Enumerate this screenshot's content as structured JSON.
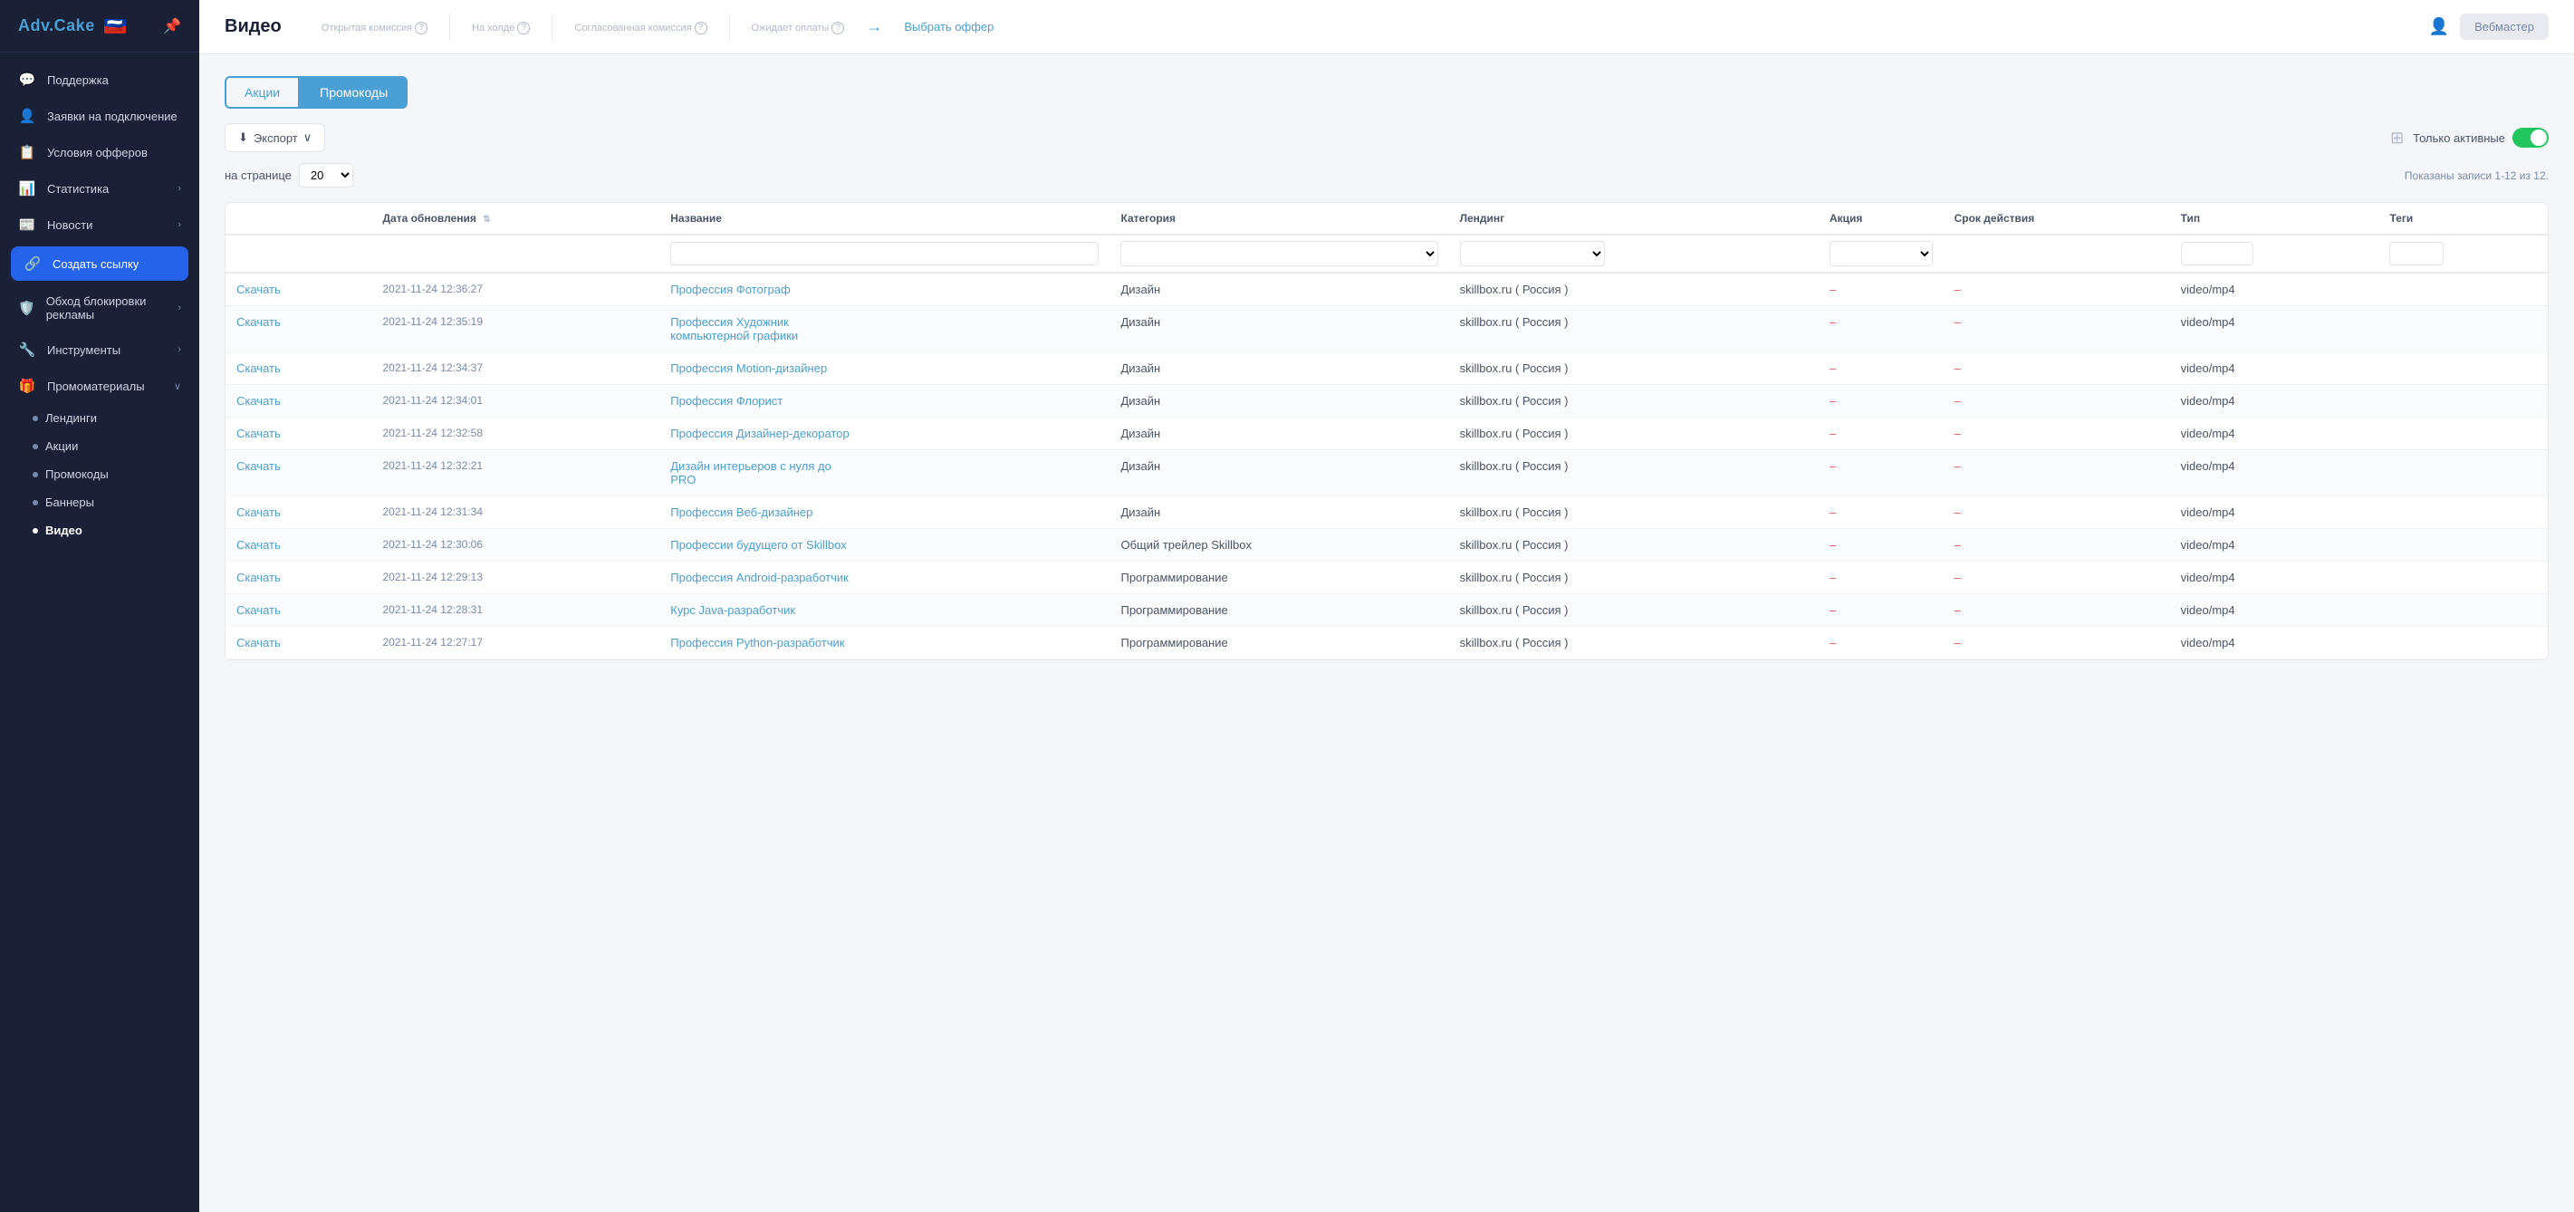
{
  "sidebar": {
    "logo": "Adv.Cake",
    "flag": "🇷🇺",
    "nav_items": [
      {
        "id": "support",
        "label": "Поддержка",
        "icon": "💬",
        "has_arrow": false
      },
      {
        "id": "connect_requests",
        "label": "Заявки на подключение",
        "icon": "👤",
        "has_arrow": false
      },
      {
        "id": "offer_conditions",
        "label": "Условия офферов",
        "icon": "📋",
        "has_arrow": false
      },
      {
        "id": "statistics",
        "label": "Статистика",
        "icon": "📊",
        "has_arrow": true
      },
      {
        "id": "news",
        "label": "Новости",
        "icon": "📰",
        "has_arrow": true
      },
      {
        "id": "create_link",
        "label": "Создать ссылку",
        "icon": "🔗",
        "highlighted": true
      },
      {
        "id": "ad_block",
        "label": "Обход блокировки рекламы",
        "icon": "🛡️",
        "has_arrow": true
      },
      {
        "id": "tools",
        "label": "Инструменты",
        "icon": "🔧",
        "has_arrow": true
      },
      {
        "id": "promo",
        "label": "Промоматериалы",
        "icon": "🎁",
        "has_arrow": true,
        "expanded": true
      }
    ],
    "promo_sub_items": [
      {
        "id": "landings",
        "label": "Лендинги",
        "active": false
      },
      {
        "id": "aktsii",
        "label": "Акции",
        "active": false
      },
      {
        "id": "promo_codes",
        "label": "Промокоды",
        "active": false
      },
      {
        "id": "banners",
        "label": "Баннеры",
        "active": false
      },
      {
        "id": "video",
        "label": "Видео",
        "active": true
      }
    ]
  },
  "header": {
    "page_title": "Видео",
    "stats": [
      {
        "id": "open_commission",
        "label": "Открытая комиссия",
        "value": ""
      },
      {
        "id": "on_hold",
        "label": "На холде",
        "value": ""
      },
      {
        "id": "agreed_commission",
        "label": "Согласованная комиссия",
        "value": ""
      },
      {
        "id": "awaiting_payment",
        "label": "Ожидает оплаты",
        "value": ""
      }
    ],
    "select_offer_label": "Выбрать оффер",
    "webmaster_label": "Вебмастер"
  },
  "toolbar": {
    "tab_aktsii": "Акции",
    "tab_promo_codes": "Промокоды",
    "export_label": "Экспорт",
    "only_active_label": "Только активные",
    "per_page_label": "на странице",
    "per_page_value": "20",
    "records_info": "Показаны записи 1-12 из 12."
  },
  "table": {
    "columns": [
      {
        "id": "action",
        "label": ""
      },
      {
        "id": "update_date",
        "label": "Дата обновления",
        "sortable": true
      },
      {
        "id": "name",
        "label": "Название"
      },
      {
        "id": "category",
        "label": "Категория"
      },
      {
        "id": "landing",
        "label": "Лендинг"
      },
      {
        "id": "aktsiya",
        "label": "Акция"
      },
      {
        "id": "validity",
        "label": "Срок действия"
      },
      {
        "id": "type",
        "label": "Тип"
      },
      {
        "id": "tags",
        "label": "Теги"
      }
    ],
    "rows": [
      {
        "action": "Скачать",
        "update_date": "2021-11-24 12:36:27",
        "name": "Профессия Фотограф",
        "category": "Дизайн",
        "landing": "skillbox.ru ( Россия )",
        "aktsiya": "–",
        "validity": "–",
        "type": "video/mp4",
        "tags": ""
      },
      {
        "action": "Скачать",
        "update_date": "2021-11-24 12:35:19",
        "name": "Профессия Художник компьютерной графики",
        "category": "Дизайн",
        "landing": "skillbox.ru ( Россия )",
        "aktsiya": "–",
        "validity": "–",
        "type": "video/mp4",
        "tags": ""
      },
      {
        "action": "Скачать",
        "update_date": "2021-11-24 12:34:37",
        "name": "Профессия Motion-дизайнер",
        "category": "Дизайн",
        "landing": "skillbox.ru ( Россия )",
        "aktsiya": "–",
        "validity": "–",
        "type": "video/mp4",
        "tags": ""
      },
      {
        "action": "Скачать",
        "update_date": "2021-11-24 12:34:01",
        "name": "Профессия Флорист",
        "category": "Дизайн",
        "landing": "skillbox.ru ( Россия )",
        "aktsiya": "–",
        "validity": "–",
        "type": "video/mp4",
        "tags": ""
      },
      {
        "action": "Скачать",
        "update_date": "2021-11-24 12:32:58",
        "name": "Профессия Дизайнер-декоратор",
        "category": "Дизайн",
        "landing": "skillbox.ru ( Россия )",
        "aktsiya": "–",
        "validity": "–",
        "type": "video/mp4",
        "tags": ""
      },
      {
        "action": "Скачать",
        "update_date": "2021-11-24 12:32:21",
        "name": "Дизайн интерьеров с нуля до PRO",
        "category": "Дизайн",
        "landing": "skillbox.ru ( Россия )",
        "aktsiya": "–",
        "validity": "–",
        "type": "video/mp4",
        "tags": ""
      },
      {
        "action": "Скачать",
        "update_date": "2021-11-24 12:31:34",
        "name": "Профессия Веб-дизайнер",
        "category": "Дизайн",
        "landing": "skillbox.ru ( Россия )",
        "aktsiya": "–",
        "validity": "–",
        "type": "video/mp4",
        "tags": ""
      },
      {
        "action": "Скачать",
        "update_date": "2021-11-24 12:30:06",
        "name": "Профессии будущего от Skillbox",
        "category": "Общий трейлер Skillbox",
        "landing": "skillbox.ru ( Россия )",
        "aktsiya": "–",
        "validity": "–",
        "type": "video/mp4",
        "tags": ""
      },
      {
        "action": "Скачать",
        "update_date": "2021-11-24 12:29:13",
        "name": "Профессия Android-разработчик",
        "category": "Программирование",
        "landing": "skillbox.ru ( Россия )",
        "aktsiya": "–",
        "validity": "–",
        "type": "video/mp4",
        "tags": ""
      },
      {
        "action": "Скачать",
        "update_date": "2021-11-24 12:28:31",
        "name": "Курс Java-разработчик",
        "category": "Программирование",
        "landing": "skillbox.ru ( Россия )",
        "aktsiya": "–",
        "validity": "–",
        "type": "video/mp4",
        "tags": ""
      },
      {
        "action": "Скачать",
        "update_date": "2021-11-24 12:27:17",
        "name": "Профессия Python-разработчик",
        "category": "Программирование",
        "landing": "skillbox.ru ( Россия )",
        "aktsiya": "–",
        "validity": "–",
        "type": "video/mp4",
        "tags": ""
      }
    ]
  },
  "colors": {
    "accent": "#4a9fd4",
    "sidebar_bg": "#1a2035",
    "dash_color": "#e05c5c"
  }
}
